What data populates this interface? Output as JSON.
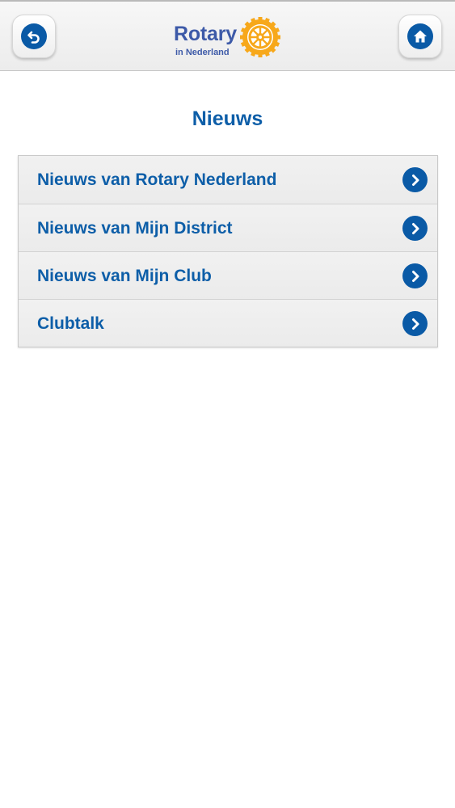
{
  "header": {
    "logo_word": "Rotary",
    "logo_sub": "in Nederland",
    "back_icon": "back-arrow-icon",
    "home_icon": "home-icon"
  },
  "page": {
    "title": "Nieuws"
  },
  "menu": {
    "items": [
      {
        "label": "Nieuws van Rotary Nederland"
      },
      {
        "label": "Nieuws van Mijn District"
      },
      {
        "label": "Nieuws van Mijn Club"
      },
      {
        "label": "Clubtalk"
      }
    ]
  },
  "colors": {
    "accent": "#0a5aa6",
    "title": "#0d5ea8",
    "logo_text": "#3d5aa8",
    "logo_gold": "#f7a81b"
  }
}
